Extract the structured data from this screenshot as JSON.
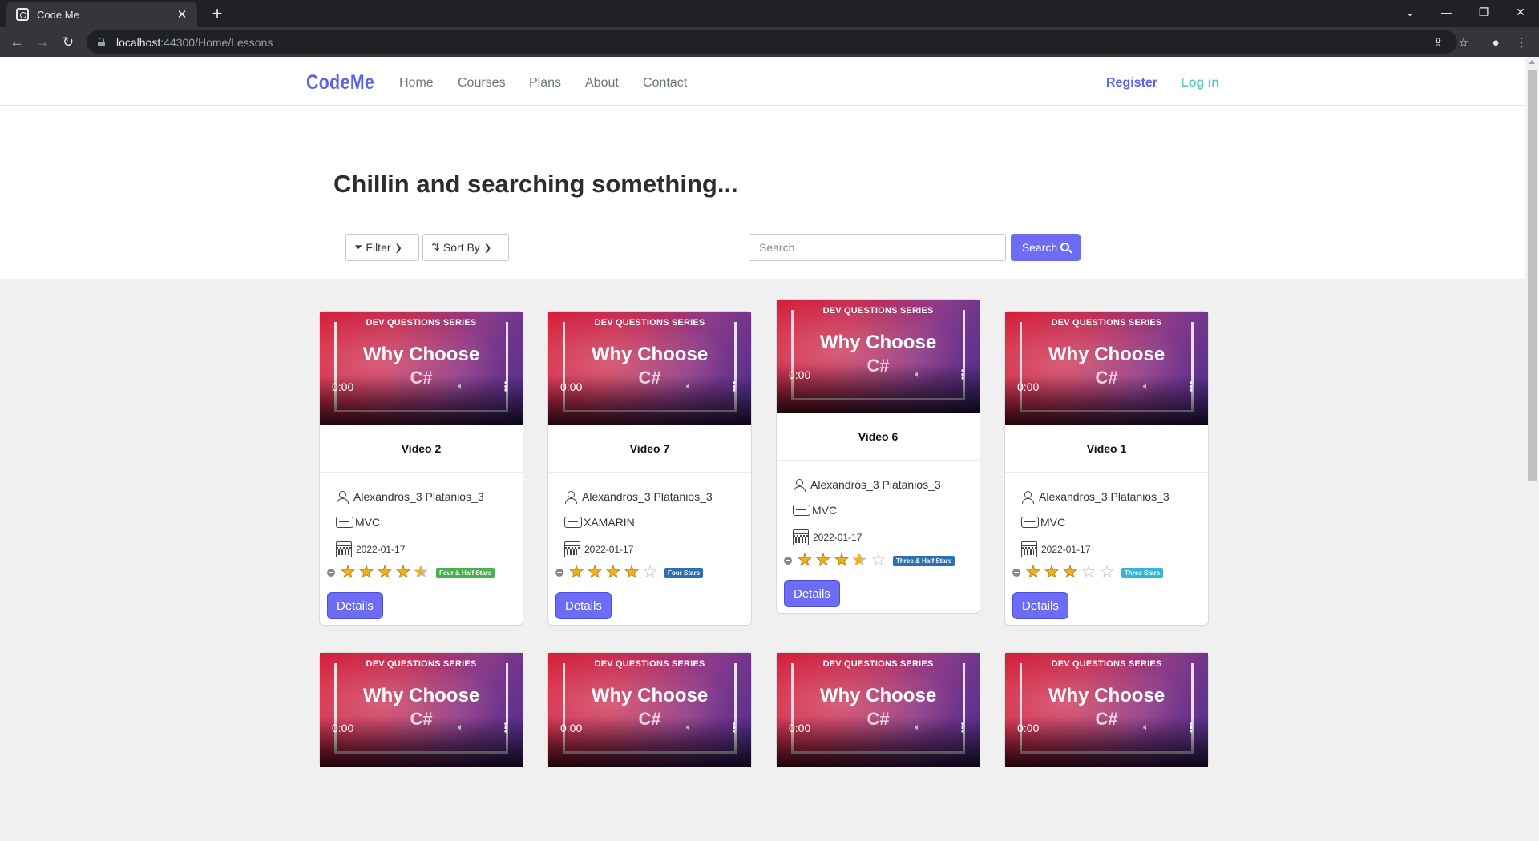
{
  "browser": {
    "tab_title": "Code Me",
    "url_host": "localhost",
    "url_rest": ":44300/Home/Lessons"
  },
  "site": {
    "brand": "CodeMe",
    "nav": [
      "Home",
      "Courses",
      "Plans",
      "About",
      "Contact"
    ],
    "register": "Register",
    "login": "Log in",
    "accent_color": "#6c6cf5"
  },
  "hero": {
    "title": "Chillin and searching something...",
    "filter_label": "Filter",
    "sort_label": "Sort By",
    "search_placeholder": "Search",
    "search_button": "Search"
  },
  "thumbnail": {
    "series": "DEV QUESTIONS SERIES",
    "line1": "Why Choose",
    "line2": "C#",
    "time": "0:00"
  },
  "details_label": "Details",
  "lessons": [
    {
      "title": "Video 2",
      "author": "Alexandros_3 Platanios_3",
      "category": "MVC",
      "date": "2022-01-17",
      "rating": 4.5,
      "badge": "Four & Half Stars",
      "badge_color": "#4caf50"
    },
    {
      "title": "Video 7",
      "author": "Alexandros_3 Platanios_3",
      "category": "XAMARIN",
      "date": "2022-01-17",
      "rating": 4,
      "badge": "Four Stars",
      "badge_color": "#2d6fb4"
    },
    {
      "title": "Video 6",
      "author": "Alexandros_3 Platanios_3",
      "category": "MVC",
      "date": "2022-01-17",
      "rating": 3.5,
      "badge": "Three & Half Stars",
      "badge_color": "#2d6fb4"
    },
    {
      "title": "Video 1",
      "author": "Alexandros_3 Platanios_3",
      "category": "MVC",
      "date": "2022-01-17",
      "rating": 3,
      "badge": "Three Stars",
      "badge_color": "#35b6d6"
    }
  ]
}
